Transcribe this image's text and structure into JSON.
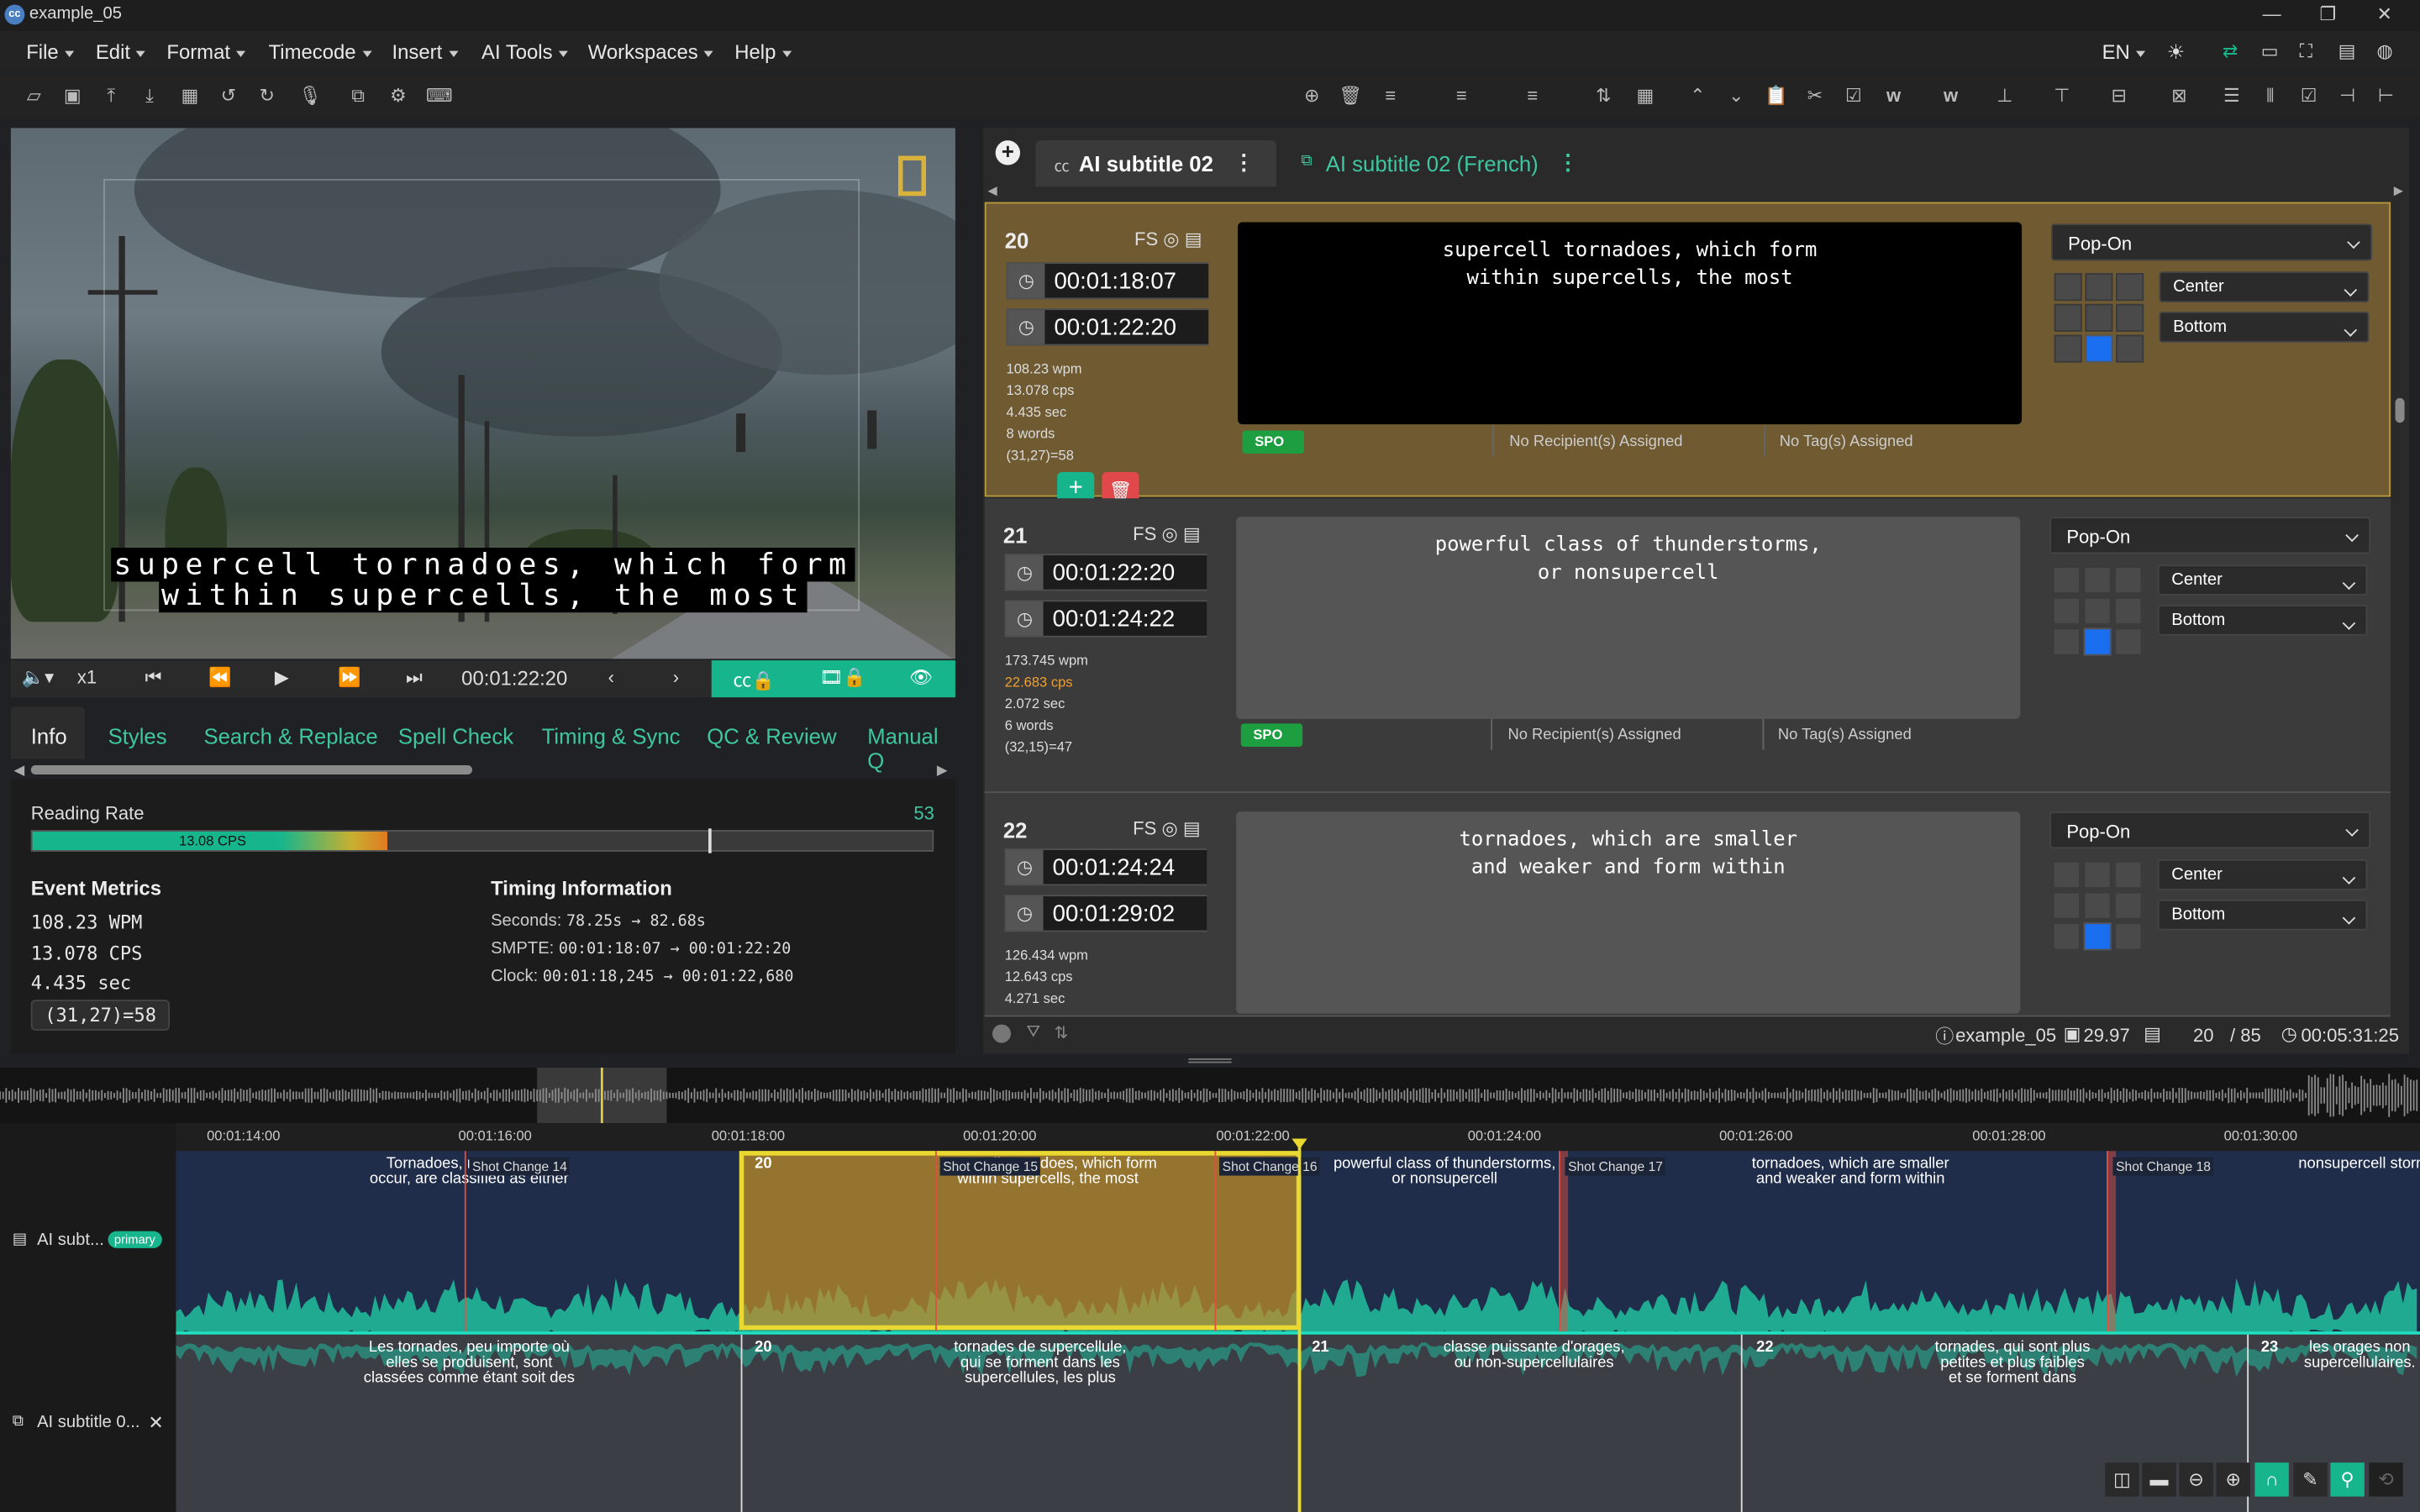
{
  "window": {
    "title": "example_05",
    "app_icon": "cc"
  },
  "menu": [
    "File",
    "Edit",
    "Format",
    "Timecode",
    "Insert",
    "AI Tools",
    "Workspaces",
    "Help"
  ],
  "menu_right": {
    "language": "EN"
  },
  "video": {
    "subtitle_line1": "supercell tornadoes, which form",
    "subtitle_line2": "within supercells, the most"
  },
  "transport": {
    "speed": "x1",
    "timecode": "00:01:22:20"
  },
  "tabs": [
    "Info",
    "Styles",
    "Search & Replace",
    "Spell Check",
    "Timing & Sync",
    "QC & Review",
    "Manual Q"
  ],
  "reading_rate": {
    "label": "Reading Rate",
    "value": "53",
    "bar_label": "13.08 CPS",
    "fill": 0.395
  },
  "event_metrics": {
    "title": "Event Metrics",
    "wpm": "108.23 WPM",
    "cps": "13.078 CPS",
    "sec": "4.435 sec",
    "pos": "(31,27)=58"
  },
  "timing_info": {
    "title": "Timing Information",
    "seconds_label": "Seconds:",
    "seconds_value": "78.25s → 82.68s",
    "smpte_label": "SMPTE:",
    "smpte_value": "00:01:18:07 → 00:01:22:20",
    "clock_label": "Clock:",
    "clock_value": "00:01:18,245 → 00:01:22,680"
  },
  "subtitle_tabs": {
    "tab1": "AI subtitle 02",
    "tab2": "AI subtitle 02 (French)"
  },
  "cards": [
    {
      "num": "20",
      "fs": "FS",
      "in": "00:01:18:07",
      "out": "00:01:22:20",
      "wpm": "108.23 wpm",
      "cps": "13.078 cps",
      "sec": "4.435 sec",
      "words": "8 words",
      "pos": "(31,27)=58",
      "line1": "supercell tornadoes, which form",
      "line2": "within supercells, the most",
      "spo": "SPO",
      "recip": "No Recipient(s) Assigned",
      "tags": "No Tag(s) Assigned",
      "mode": "Pop-On",
      "halign": "Center",
      "valign": "Bottom"
    },
    {
      "num": "21",
      "fs": "FS",
      "in": "00:01:22:20",
      "out": "00:01:24:22",
      "wpm": "173.745 wpm",
      "cps": "22.683 cps",
      "sec": "2.072 sec",
      "words": "6 words",
      "pos": "(32,15)=47",
      "line1": "powerful class of thunderstorms,",
      "line2": "or nonsupercell",
      "spo": "SPO",
      "recip": "No Recipient(s) Assigned",
      "tags": "No Tag(s) Assigned",
      "mode": "Pop-On",
      "halign": "Center",
      "valign": "Bottom"
    },
    {
      "num": "22",
      "fs": "FS",
      "in": "00:01:24:24",
      "out": "00:01:29:02",
      "wpm": "126.434 wpm",
      "cps": "12.643 cps",
      "sec": "4.271 sec",
      "line1": "tornadoes, which are smaller",
      "line2": "and weaker and form within",
      "mode": "Pop-On",
      "halign": "Center",
      "valign": "Bottom"
    }
  ],
  "status": {
    "file": "example_05",
    "fps": "29.97",
    "current": "20",
    "total": "/ 85",
    "duration": "00:05:31:25"
  },
  "ruler": [
    "00:01:14:00",
    "00:01:16:00",
    "00:01:18:00",
    "00:01:20:00",
    "00:01:22:00",
    "00:01:24:00",
    "00:01:26:00",
    "00:01:28:00",
    "00:01:30:00"
  ],
  "track1": {
    "label": "AI subt...",
    "badge": "primary",
    "segs": [
      {
        "text": "Tornadoes, no ma... can\noccur, are classified as either"
      },
      {
        "num": "20",
        "text": "supercell tornadoes, which form\nwithin supercells, the most"
      },
      {
        "text": "powerful class of thunderstorms,\nor nonsupercell"
      },
      {
        "text": "tornadoes, which are smaller\nand weaker and form within"
      },
      {
        "text": "nonsupercell storms"
      }
    ],
    "shots": [
      "Shot Change 14",
      "Shot Change 15",
      "Shot Change 16",
      "Shot Change 17",
      "Shot Change 18"
    ]
  },
  "track2": {
    "label": "AI subtitle 0...",
    "segs": [
      {
        "text": "Les tornades, peu importe où\nelles se produisent, sont\nclassées comme étant soit des"
      },
      {
        "num": "20",
        "text": "tornades de supercellule,\nqui se forment dans les\nsupercellules, les plus"
      },
      {
        "num": "21",
        "text": "classe puissante d'orages,\nou non-supercellulaires"
      },
      {
        "num": "22",
        "text": "tornades, qui sont plus\npetites et plus faibles\net se forment dans"
      },
      {
        "num": "23",
        "text": "les orages non\nsupercellulaires."
      }
    ]
  },
  "colors": {
    "accent": "#17b58c",
    "selected_card": "#6f5a32",
    "shot_change": "#e05040",
    "warning": "#f0a030"
  }
}
